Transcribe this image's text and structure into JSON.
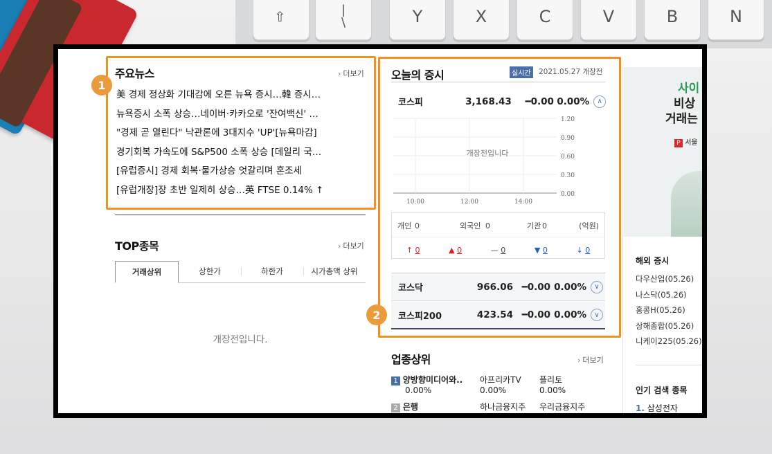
{
  "background": {
    "keys": [
      "⇧",
      "|\n\\",
      "Y",
      "X",
      "C",
      "V",
      "B",
      "N"
    ]
  },
  "colors": {
    "highlight": "#f0921f",
    "marker": "#eb9a3c",
    "up": "#e02020",
    "down": "#2060d0",
    "realtime_badge": "#4a6ea8"
  },
  "markers": {
    "first": "1",
    "second": "2"
  },
  "news": {
    "title": "주요뉴스",
    "more": "더보기",
    "items": [
      "美 경제 정상화 기대감에 오른 뉴욕 증시…韓 증시…",
      "뉴욕증시 소폭 상승…네이버·카카오로 '잔여백신' …",
      "\"경제 곧 열린다\" 낙관론에 3대지수 'UP'[뉴욕마감]",
      "경기회복 가속도에 S&P500 소폭 상승 [데일리 국…",
      "[유럽증시] 경제 회복·물가상승 엇갈리며 혼조세",
      "[유럽개장]장 초반 일제히 상승…英 FTSE 0.14% ↑"
    ]
  },
  "top": {
    "title": "TOP종목",
    "more": "더보기",
    "tabs": [
      "거래상위",
      "상한가",
      "하한가",
      "시가총액 상위"
    ],
    "empty": "개장전입니다."
  },
  "market": {
    "title": "오늘의 증시",
    "badge": "실시간",
    "date": "2021.05.27 개장전",
    "kospi": {
      "name": "코스피",
      "value": "3,168.43",
      "change": "━0.00",
      "rate": "0.00%"
    },
    "chart_notice": "개장전입니다",
    "investors": {
      "individual": "개인",
      "individual_val": "0",
      "foreign": "외국인",
      "foreign_val": "0",
      "institution": "기관",
      "institution_val": "0",
      "unit": "(억원)"
    },
    "breadth": [
      {
        "icon": "↑",
        "value": "0"
      },
      {
        "icon": "▲",
        "value": "0"
      },
      {
        "icon": "—",
        "value": "0"
      },
      {
        "icon": "▼",
        "value": "0"
      },
      {
        "icon": "↓",
        "value": "0"
      }
    ],
    "kosdaq": {
      "name": "코스닥",
      "value": "966.06",
      "change": "━0.00",
      "rate": "0.00%"
    },
    "kospi200": {
      "name": "코스피200",
      "value": "423.54",
      "change": "━0.00",
      "rate": "0.00%"
    }
  },
  "chart_data": {
    "type": "line",
    "title": "",
    "xlabel": "",
    "ylabel": "",
    "x_ticks": [
      "10:00",
      "12:00",
      "14:00"
    ],
    "y_ticks": [
      "1.20",
      "0.90",
      "0.60",
      "0.30",
      "0.00"
    ],
    "ylim": [
      0,
      1.2
    ],
    "series": [],
    "grid": true
  },
  "sector": {
    "title": "업종상위",
    "more": "더보기",
    "rows": [
      {
        "rank": "1",
        "name": "양방향미디어와..",
        "rate": "0.00%",
        "s1": "아프리카TV",
        "s1r": "0.00%",
        "s2": "플리토",
        "s2r": "0.00%"
      },
      {
        "rank": "2",
        "name": "은행",
        "rate": "",
        "s1": "하나금융지주",
        "s1r": "",
        "s2": "우리금융지주",
        "s2r": ""
      }
    ]
  },
  "ad": {
    "line1": "사이",
    "line2": "비상",
    "line3": "거래는",
    "brand": "서울"
  },
  "overseas": {
    "title": "해외 증시",
    "items": [
      "다우산업(05.26)",
      "나스닥(05.26)",
      "홍콩H(05.26)",
      "상해종합(05.26)",
      "니케이225(05.26)"
    ]
  },
  "popular": {
    "title": "인기 검색 종목",
    "first_rank": "1.",
    "first_item": "삼성전자"
  }
}
